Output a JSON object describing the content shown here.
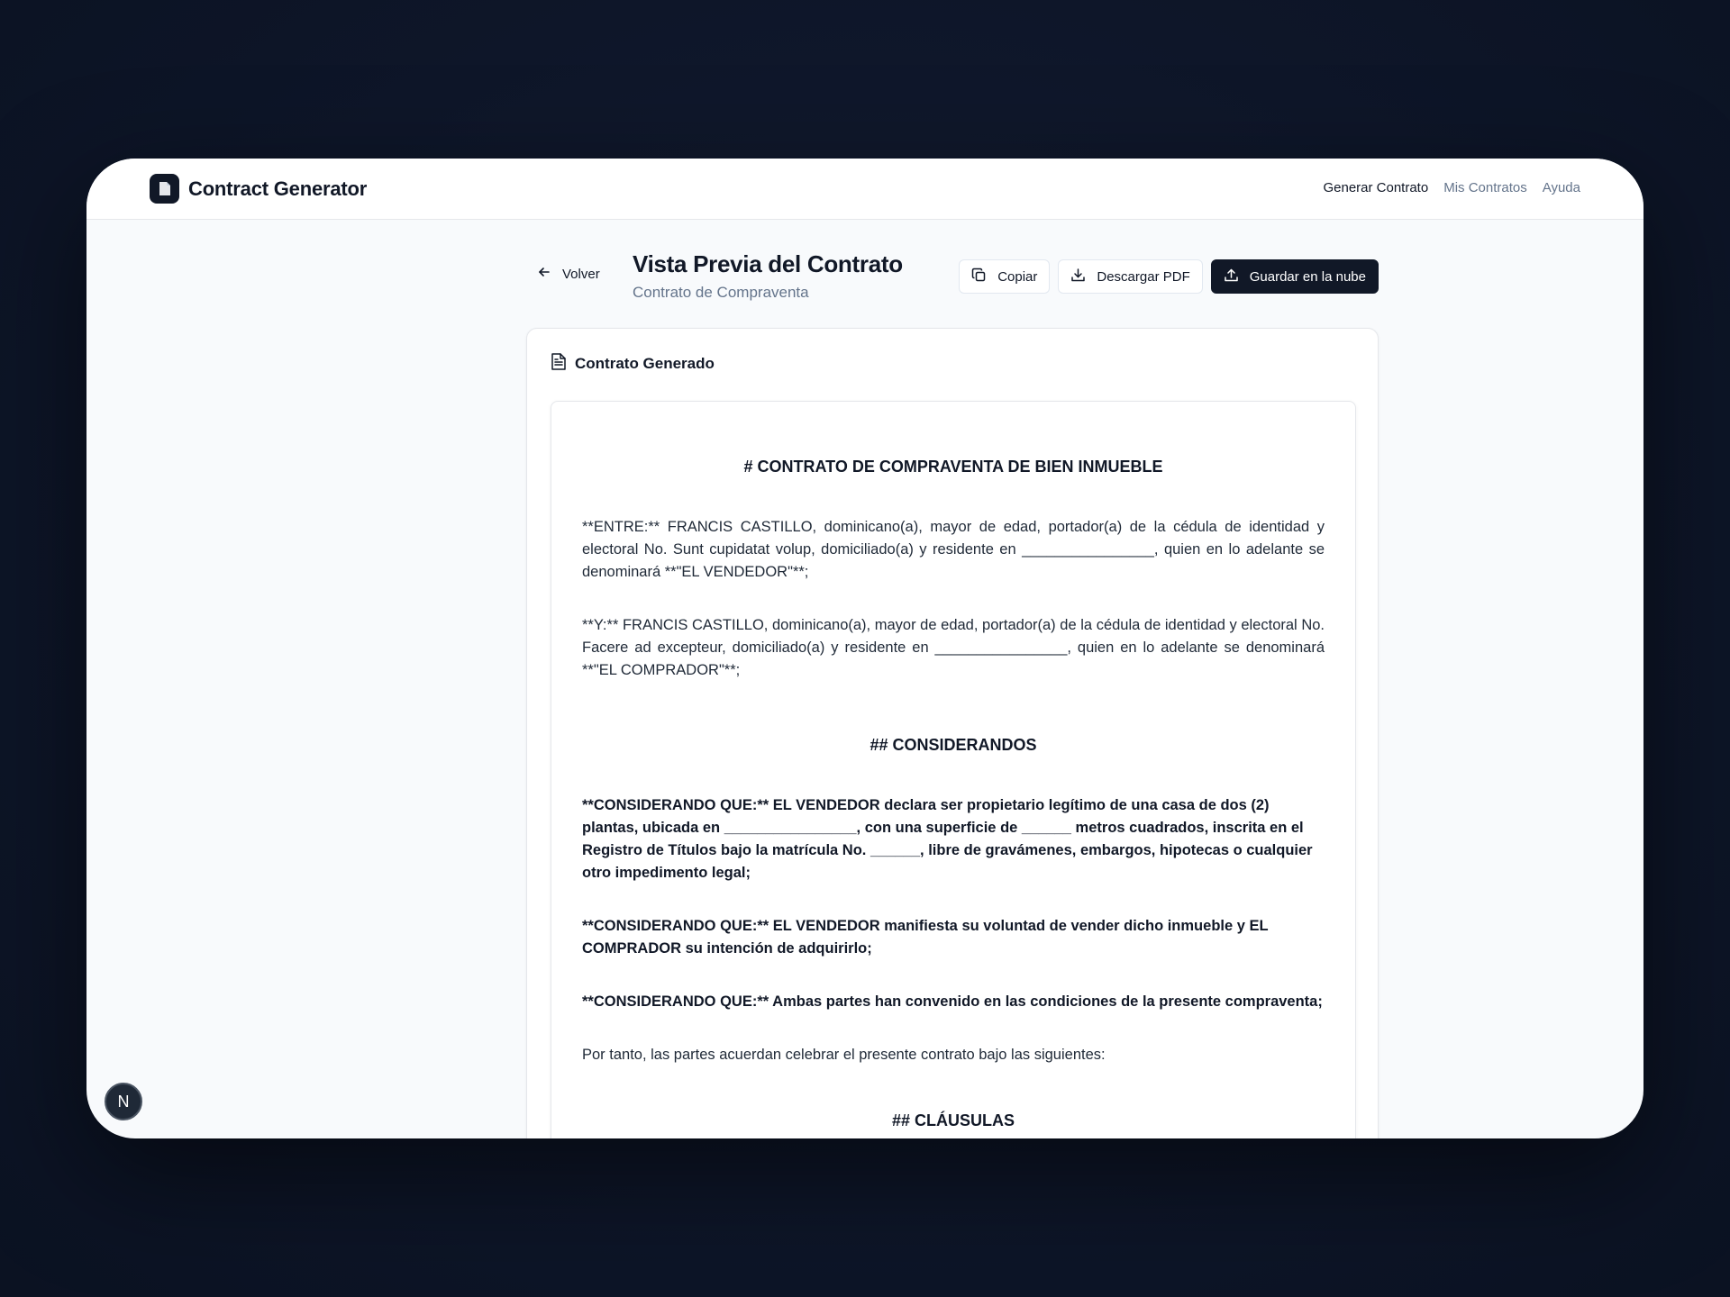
{
  "app": {
    "name": "Contract Generator",
    "logo_icon": "document-icon"
  },
  "nav": {
    "items": [
      {
        "label": "Generar Contrato",
        "active": true
      },
      {
        "label": "Mis Contratos",
        "active": false
      },
      {
        "label": "Ayuda",
        "active": false
      }
    ]
  },
  "header": {
    "back_label": "Volver",
    "title": "Vista Previa del Contrato",
    "subtitle": "Contrato de Compraventa",
    "copy_label": "Copiar",
    "download_label": "Descargar PDF",
    "save_label": "Guardar en la nube"
  },
  "card": {
    "title": "Contrato Generado"
  },
  "document": {
    "heading": "# CONTRATO DE COMPRAVENTA DE BIEN INMUEBLE",
    "para_entre": "**ENTRE:** FRANCIS CASTILLO, dominicano(a), mayor de edad, portador(a) de la cédula de identidad y electoral No. Sunt cupidatat volup, domiciliado(a) y residente en ________________, quien en lo adelante se denominará **\"EL VENDEDOR\"**;",
    "para_y": "**Y:** FRANCIS CASTILLO, dominicano(a), mayor de edad, portador(a) de la cédula de identidad y electoral No. Facere ad excepteur, domiciliado(a) y residente en ________________, quien en lo adelante se denominará **\"EL COMPRADOR\"**;",
    "considerandos_heading": "## CONSIDERANDOS",
    "considerando_1": "**CONSIDERANDO QUE:** EL VENDEDOR declara ser propietario legítimo de una casa de dos (2) plantas, ubicada en ________________, con una superficie de ______ metros cuadrados, inscrita en el Registro de Títulos bajo la matrícula No. ______, libre de gravámenes, embargos, hipotecas o cualquier otro impedimento legal;",
    "considerando_2": "**CONSIDERANDO QUE:** EL VENDEDOR manifiesta su voluntad de vender dicho inmueble y EL COMPRADOR su intención de adquirirlo;",
    "considerando_3": "**CONSIDERANDO QUE:** Ambas partes han convenido en las condiciones de la presente compraventa;",
    "por_tanto": "Por tanto, las partes acuerdan celebrar el presente contrato bajo las siguientes:",
    "cut_heading": "## CLÁUSULAS"
  },
  "badge": {
    "label": "N"
  },
  "colors": {
    "background": "#0f172a",
    "primary": "#111827",
    "muted_text": "#64748b",
    "surface": "#ffffff",
    "page": "#f8fafc"
  }
}
